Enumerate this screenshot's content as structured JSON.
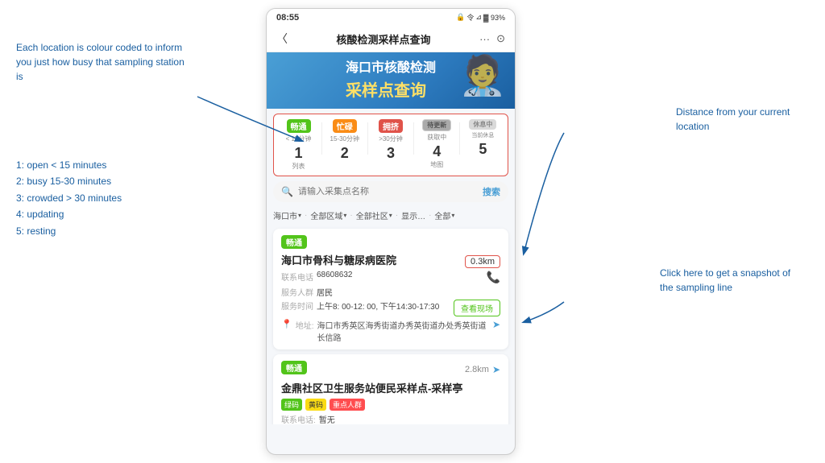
{
  "annotations": {
    "left_top": "Each location is colour coded to inform you just how busy that sampling station is",
    "legend_1": "1: open < 15 minutes",
    "legend_2": "2: busy 15-30 minutes",
    "legend_3": "3: crowded > 30 minutes",
    "legend_4": "4: updating",
    "legend_5": "5: resting",
    "right_top": "Distance from your current location",
    "right_bottom": "Click here to get a snapshot of the sampling line"
  },
  "status_bar": {
    "time": "08:55",
    "icons": "🔒 令 ⊿ 🔋 93%"
  },
  "nav": {
    "back": "〈",
    "title": "核酸检测采样点查询",
    "more": "···",
    "target": "⊙"
  },
  "banner": {
    "line1": "海口市核酸检测",
    "line2": "采样点查询"
  },
  "tabs": [
    {
      "badge": "畅通",
      "badge_class": "badge-green",
      "sub": "< 15分钟",
      "num": "1",
      "label": "列表"
    },
    {
      "badge": "忙碌",
      "badge_class": "badge-orange",
      "sub": "15-30分钟",
      "num": "2",
      "label": ""
    },
    {
      "badge": "拥挤",
      "badge_class": "badge-red",
      "sub": ">30分钟",
      "num": "3",
      "label": ""
    },
    {
      "badge": "待更新",
      "badge_class": "badge-gray",
      "sub": "获取中",
      "num": "4",
      "label": "地图"
    },
    {
      "badge": "休息中",
      "badge_class": "badge-lightgray",
      "sub": "当前休息",
      "num": "5",
      "label": ""
    }
  ],
  "search": {
    "placeholder": "请输入采集点名称",
    "button": "搜索"
  },
  "filters": [
    "海口市",
    "全部区域",
    "全部社区",
    "显示…",
    "全部"
  ],
  "card1": {
    "badge": "畅通",
    "distance": "0.3km",
    "title": "海口市骨科与糖尿病医院",
    "phone_label": "联系电话",
    "phone_val": "68608632",
    "group_label": "服务人群",
    "group_val": "居民",
    "time_label": "服务时间",
    "time_val": "上午8: 00-12: 00, 下午14:30-17:30",
    "view_btn": "查看现场",
    "addr_label": "地址:",
    "addr_val": "海口市秀英区海秀街道办秀英街道办处秀英街道长信路"
  },
  "card2": {
    "badge": "畅通",
    "distance": "2.8km",
    "title": "金鼎社区卫生服务站便民采样点-采样亭",
    "tag1": "绿码",
    "tag2": "黄码",
    "tag3": "重点人群",
    "phone_label": "联系电话:",
    "phone_val": "暂无"
  }
}
